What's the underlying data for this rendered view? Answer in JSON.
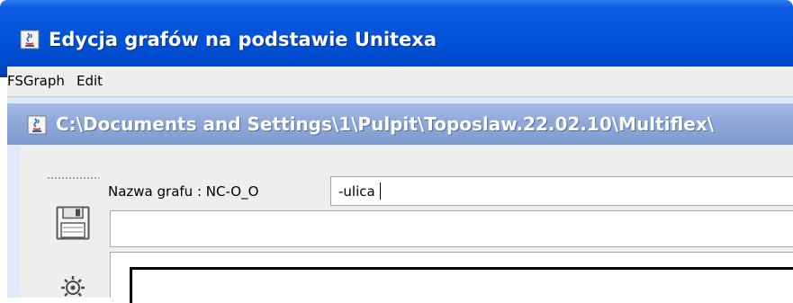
{
  "window": {
    "title": "Edycja grafów na podstawie Unitexa"
  },
  "menubar": {
    "items": [
      "FSGraph",
      "Edit"
    ]
  },
  "internal_frame": {
    "title": "C:\\Documents and Settings\\1\\Pulpit\\Toposlaw.22.02.10\\Multiflex\\"
  },
  "graph_editor": {
    "name_label": "Nazwa grafu : NC-O_O",
    "name_value": "-ulica",
    "path_value": ""
  },
  "toolbar": {
    "icons": [
      "save-icon",
      "gear-icon"
    ]
  },
  "colors": {
    "titlebar": "#0052d8",
    "inner_titlebar": "#8fa8d8",
    "menubar": "#eeeeee"
  }
}
